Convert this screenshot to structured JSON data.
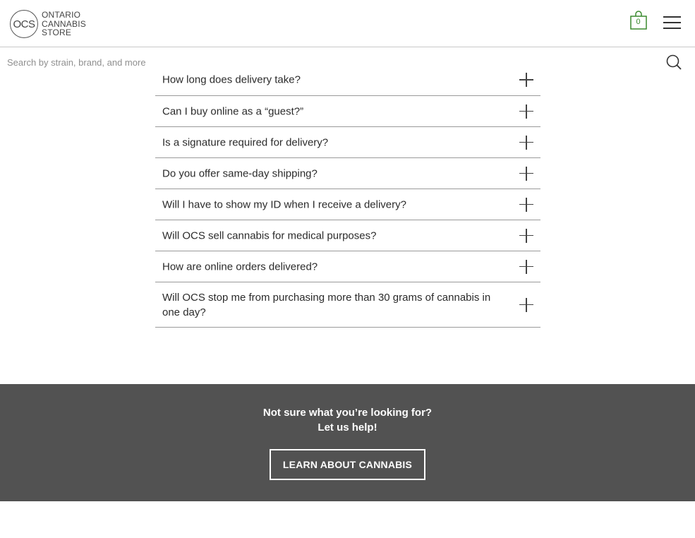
{
  "header": {
    "logo": {
      "badge": "OCS",
      "lines": [
        "ONTARIO",
        "CANNABIS",
        "STORE"
      ]
    },
    "cart": {
      "count": "0",
      "icon": "shopping-bag-icon",
      "color": "#3a8a2e"
    },
    "menu": {
      "icon": "hamburger-menu-icon"
    }
  },
  "search": {
    "placeholder": "Search by strain, brand, and more",
    "icon": "search-icon"
  },
  "faq": {
    "items": [
      {
        "question": "How long does delivery take?"
      },
      {
        "question": "Can I buy online as a “guest?”"
      },
      {
        "question": "Is a signature required for delivery?"
      },
      {
        "question": "Do you offer same-day shipping?"
      },
      {
        "question": "Will I have to show my ID when I receive a delivery?"
      },
      {
        "question": "Will OCS sell cannabis for medical purposes?"
      },
      {
        "question": "How are online orders delivered?"
      },
      {
        "question": "Will OCS stop me from purchasing more than 30 grams of cannabis in one day?"
      }
    ],
    "expand_icon": "plus-icon"
  },
  "promo": {
    "title_line1": "Not sure what you’re looking for?",
    "title_line2": "Let us help!",
    "button_label": "LEARN ABOUT CANNABIS",
    "background": "#525252"
  }
}
